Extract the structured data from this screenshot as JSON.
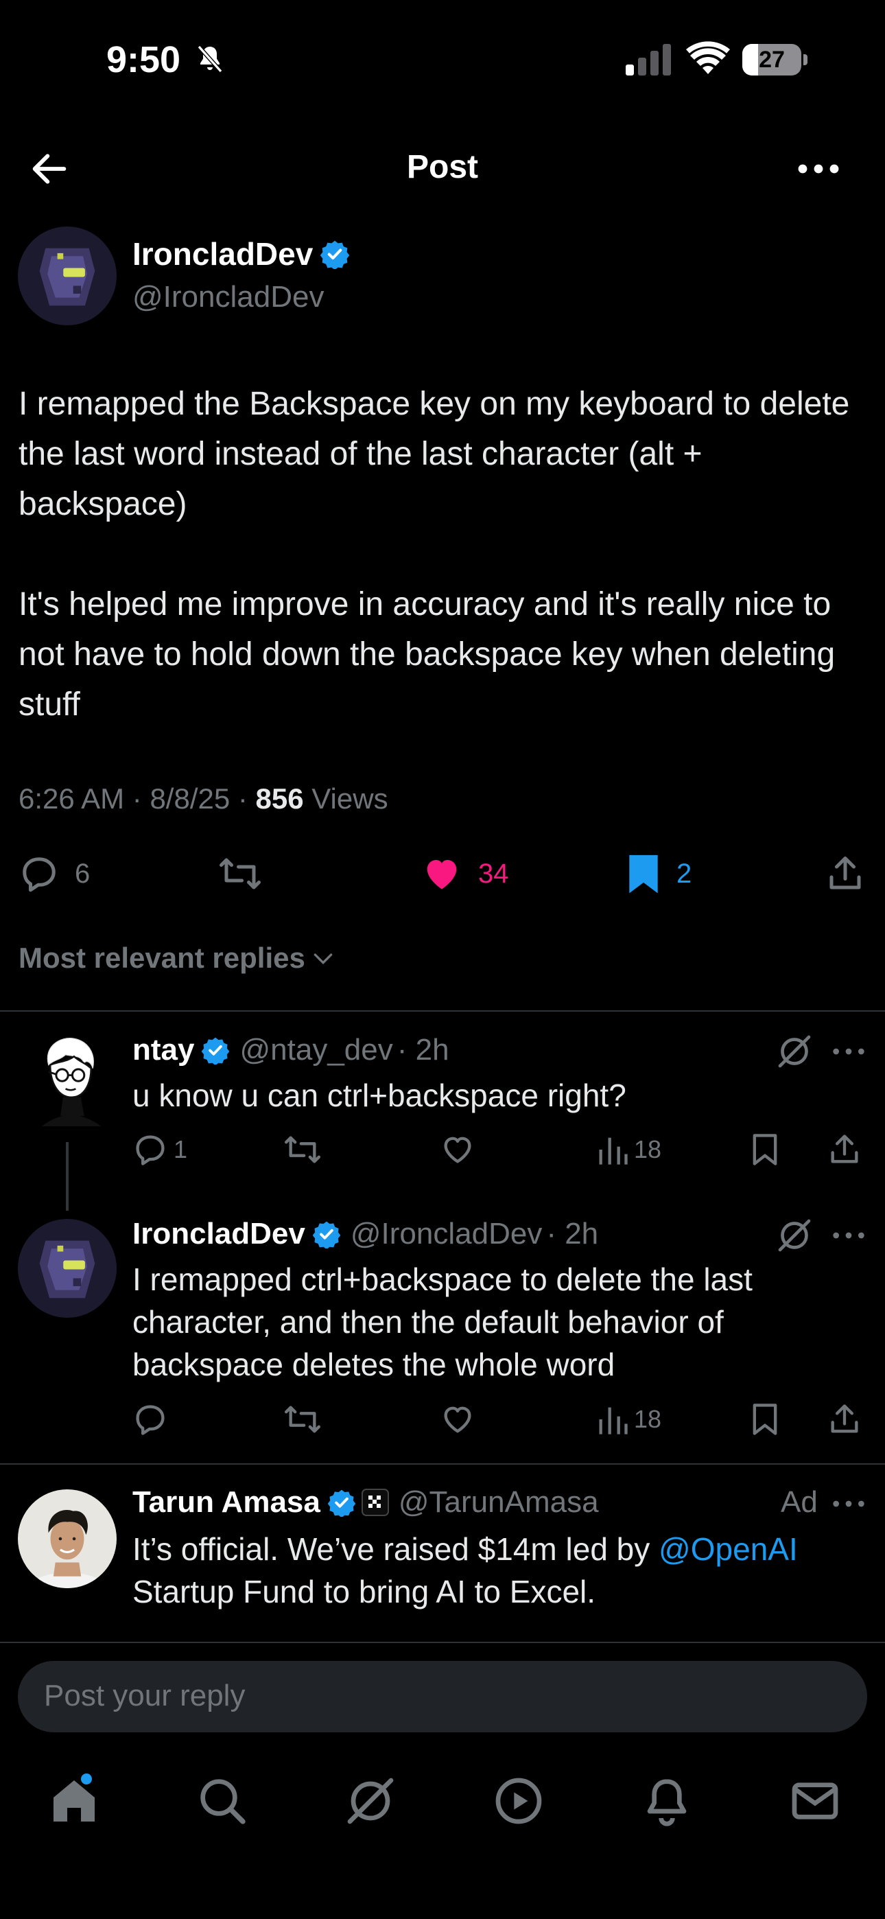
{
  "status_bar": {
    "time": "9:50",
    "battery": "27",
    "battery_level": 0.27
  },
  "header": {
    "title": "Post"
  },
  "post": {
    "display_name": "IroncladDev",
    "handle": "@IroncladDev",
    "text": "I remapped the Backspace key on my keyboard to delete the last word instead of the last character (alt + backspace)\n\nIt's helped me improve in accuracy and it's really nice to not have to hold down the backspace key when deleting stuff",
    "time": "6:26 AM",
    "date": "8/8/25",
    "views_count": "856",
    "views_label": "Views",
    "replies": "6",
    "likes": "34",
    "bookmarks": "2"
  },
  "sort": {
    "label": "Most relevant replies"
  },
  "replies": [
    {
      "display_name": "ntay",
      "handle": "@ntay_dev",
      "time": "· 2h",
      "text": "u know u can ctrl+backspace right?",
      "replies": "1",
      "views": "18"
    },
    {
      "display_name": "IroncladDev",
      "handle": "@IroncladDev",
      "time": "· 2h",
      "text": "I remapped ctrl+backspace to delete the last character, and then the default behavior of backspace deletes the whole word",
      "views": "18"
    }
  ],
  "ad": {
    "display_name": "Tarun Amasa",
    "handle": "@TarunAmasa",
    "ad_label": "Ad",
    "text_before": "It’s official. We’ve raised $14m led by ",
    "mention": "@OpenAI",
    "text_after": " Startup Fund to bring AI to Excel."
  },
  "reply_box": {
    "placeholder": "Post your reply"
  },
  "colors": {
    "like": "#f91880",
    "bookmark": "#1d9bf0",
    "verified": "#1d9bf0",
    "muted": "#71767b",
    "background": "#000000"
  },
  "icons": [
    "bell-slash-icon",
    "signal-icon",
    "wifi-icon",
    "back-arrow-icon",
    "more-icon",
    "verified-icon",
    "reply-icon",
    "repost-icon",
    "heart-icon",
    "bookmark-icon",
    "share-icon",
    "grok-icon",
    "views-icon",
    "home-icon",
    "search-icon",
    "grok-nav-icon",
    "play-icon",
    "bell-icon",
    "mail-icon"
  ]
}
